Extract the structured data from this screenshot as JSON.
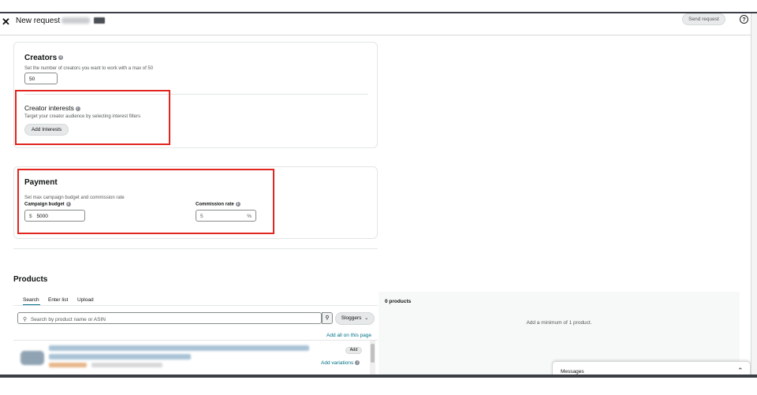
{
  "header": {
    "title": "New request",
    "send_request": "Send request",
    "help": "?"
  },
  "creators": {
    "title": "Creators",
    "subtitle": "Set the number of creators you want to work with a max of 50",
    "value": "50"
  },
  "interests": {
    "title": "Creator interests",
    "subtitle": "Target your creator audience by selecting interest filters",
    "button": "Add Interests"
  },
  "payment": {
    "title": "Payment",
    "subtitle": "Set max campaign budget and commission rate",
    "budget_label": "Campaign budget",
    "budget_prefix": "$",
    "budget_value": "5000",
    "commission_label": "Commission rate",
    "commission_value": "5",
    "commission_suffix": "%"
  },
  "products": {
    "title": "Products",
    "tabs": [
      "Search",
      "Enter list",
      "Upload"
    ],
    "search_placeholder": "Search by product name or ASIN",
    "brand_filter": "Sloggers",
    "add_all": "Add all on this page",
    "add_button": "Add",
    "add_variations": "Add variations",
    "count_label": "0 products",
    "empty_hint": "Add a minimum of 1 product."
  },
  "messages": {
    "label": "Messages"
  },
  "icons": {
    "close": "close-icon",
    "help": "help-icon",
    "search": "search-icon",
    "chevron": "chevron-down-icon",
    "info": "info-icon"
  },
  "colors": {
    "highlight": "#e0261f",
    "link": "#007185"
  }
}
